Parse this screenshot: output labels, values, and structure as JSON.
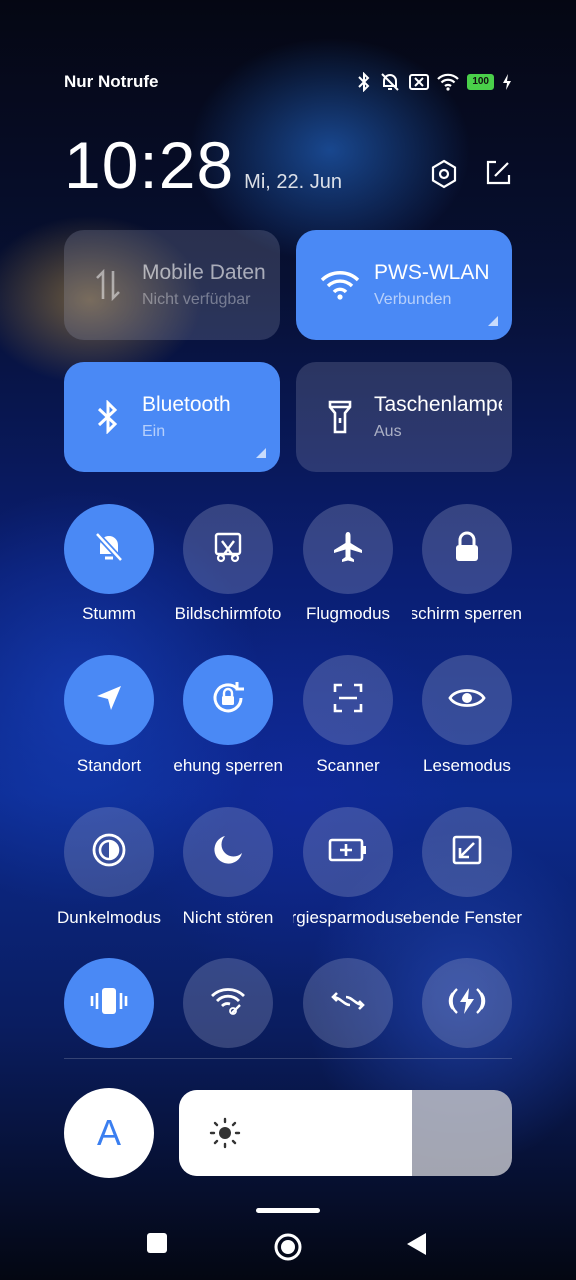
{
  "status_bar": {
    "carrier": "Nur Notrufe",
    "battery": "100",
    "icons": [
      "bluetooth-icon",
      "mute-icon",
      "no-sim-icon",
      "wifi-icon",
      "battery-icon",
      "charging-icon"
    ]
  },
  "header": {
    "time": "10:28",
    "date": "Mi, 22. Jun",
    "actions": [
      "settings-icon",
      "edit-icon"
    ]
  },
  "big_tiles": [
    {
      "title": "Mobile Daten",
      "subtitle": "Nicht verfügbar",
      "state": "off",
      "icon": "mobile-data-icon"
    },
    {
      "title": "PWS-WLAN",
      "subtitle": "Verbunden",
      "state": "on",
      "icon": "wifi-icon"
    },
    {
      "title": "Bluetooth",
      "subtitle": "Ein",
      "state": "on",
      "icon": "bluetooth-icon"
    },
    {
      "title": "Taschenlampe",
      "subtitle": "Aus",
      "state": "off",
      "icon": "flashlight-icon"
    }
  ],
  "toggles": [
    {
      "label": "Stumm",
      "state": "on",
      "icon": "mute-bell-icon"
    },
    {
      "label": "Bildschirmfoto",
      "state": "off",
      "icon": "screenshot-icon"
    },
    {
      "label": "Flugmodus",
      "state": "off",
      "icon": "airplane-icon"
    },
    {
      "label": "Bildschirm sperren",
      "state": "off",
      "icon": "lock-icon"
    },
    {
      "label": "Standort",
      "state": "on",
      "icon": "location-icon"
    },
    {
      "label": "Drehung sperren",
      "state": "on",
      "icon": "rotation-lock-icon"
    },
    {
      "label": "Scanner",
      "state": "off",
      "icon": "scanner-icon"
    },
    {
      "label": "Lesemodus",
      "state": "off",
      "icon": "eye-icon"
    },
    {
      "label": "Dunkelmodus",
      "state": "off",
      "icon": "dark-mode-icon"
    },
    {
      "label": "Nicht stören",
      "state": "off",
      "icon": "moon-icon"
    },
    {
      "label": "Energiesparmodus",
      "state": "off",
      "icon": "battery-saver-icon"
    },
    {
      "label": "Schwebende Fenster",
      "state": "off",
      "icon": "floating-window-icon"
    },
    {
      "label": "",
      "state": "on",
      "icon": "vibrate-icon"
    },
    {
      "label": "",
      "state": "off",
      "icon": "wifi-link-icon"
    },
    {
      "label": "",
      "state": "off",
      "icon": "sync-icon"
    },
    {
      "label": "",
      "state": "off",
      "icon": "power-icon"
    }
  ],
  "brightness": {
    "auto_label": "A",
    "level": 0.7,
    "icon": "sun-icon"
  },
  "navigation": [
    "recents-icon",
    "home-icon",
    "back-icon"
  ]
}
